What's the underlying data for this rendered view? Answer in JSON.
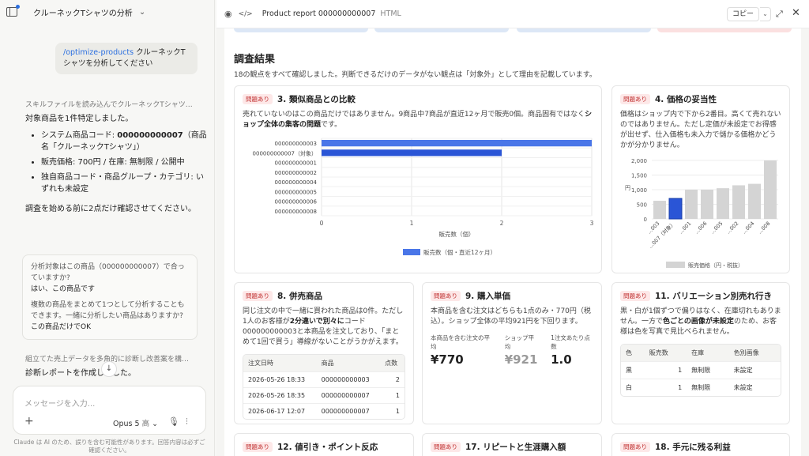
{
  "chat": {
    "title": "クルーネックTシャツの分析",
    "user_message_cmd": "/optimize-products",
    "user_message_text": " クルーネックTシャツを分析してください",
    "status_1": "スキルファイルを読み込んでクルーネックTシャツ…",
    "para_1": "対象商品を1件特定しました。",
    "bullets": [
      {
        "pre": "システム商品コード: ",
        "bold": "000000000007",
        "post": "（商品名「クルーネックTシャツ」）"
      },
      {
        "pre": "販売価格: 700円 / 在庫: 無制限 / 公開中",
        "bold": "",
        "post": ""
      },
      {
        "pre": "独自商品コード・商品グループ・カテゴリ: いずれも未設定",
        "bold": "",
        "post": ""
      }
    ],
    "para_2": "調査を始める前に2点だけ確認させてください。",
    "qa": [
      {
        "q": "分析対象はこの商品（000000000007）で合っていますか?",
        "a": "はい、この商品です"
      },
      {
        "q": "複数の商品をまとめて1つとして分析することもできます。一緒に分析したい商品はありますか?",
        "a": "この商品だけでOK"
      }
    ],
    "status_2": "組立てた売上データを多角的に診断し改善案を構…",
    "para_3": "診断レポートを作成しました。",
    "input_placeholder": "メッセージを入力...",
    "model": "Opus 5",
    "model_thinking": "高",
    "disclaimer": "Claude は AI のため、誤りを含む可能性があります。回答内容は必ずご確認ください。"
  },
  "report": {
    "title": "Product report 000000000007",
    "type": "HTML",
    "copy_label": "コピー",
    "section_title": "調査結果",
    "section_desc": "18の観点をすべて確認しました。判断できるだけのデータがない観点は「対象外」として理由を記載しています。",
    "badge": "問題あり",
    "cards": {
      "c3": {
        "title": "3. 類似商品との比較",
        "text_pre": "売れていないのはこの商品だけではありません。9商品中7商品が直近12ヶ月で販売0個。商品固有ではなく",
        "text_bold": "ショップ全体の集客の問題",
        "text_post": "です。"
      },
      "c4": {
        "title": "4. 価格の妥当性",
        "text": "価格はショップ内で下から2番目。高くて売れないのではありません。ただし定価が未設定でお得感が出せず、仕入価格も未入力で儲かる価格かどうかが分かりません。"
      },
      "c8": {
        "title": "8. 併売商品",
        "text_pre": "同じ注文の中で一緒に買われた商品は0件。ただし1人のお客様が",
        "text_bold": "2分違いで別々に",
        "text_post": "コード000000000003と本商品を注文しており、「まとめて1回で買う」導線がないことがうかがえます。",
        "headers": [
          "注文日時",
          "商品",
          "点数"
        ],
        "rows": [
          [
            "2026-05-26 18:33",
            "000000000003",
            "2"
          ],
          [
            "2026-05-26 18:35",
            "000000000007",
            "1"
          ],
          [
            "2026-06-17 12:07",
            "000000000007",
            "1"
          ]
        ]
      },
      "c9": {
        "title": "9. 購入単価",
        "text": "本商品を含む注文はどちらも1点のみ・770円（税込）。ショップ全体の平均921円を下回ります。",
        "metrics": [
          {
            "label": "本商品を含む注文の平均",
            "value": "¥770"
          },
          {
            "label": "ショップ平均",
            "value": "¥921"
          },
          {
            "label": "1注文あたり点数",
            "value": "1.0"
          }
        ]
      },
      "c11": {
        "title": "11. バリエーション別売れ行き",
        "text_pre": "黒・白が1個ずつで偏りはなく、在庫切れもありません。一方で",
        "text_bold": "色ごとの画像が未設定",
        "text_post": "のため、お客様は色を写真で見比べられません。",
        "headers": [
          "色",
          "販売数",
          "在庫",
          "色別画像"
        ],
        "rows": [
          [
            "黒",
            "1",
            "無制限",
            "未設定"
          ],
          [
            "白",
            "1",
            "無制限",
            "未設定"
          ]
        ]
      },
      "c12": {
        "title": "12. 値引き・ポイント反応"
      },
      "c17": {
        "title": "17. リピートと生涯購入額"
      },
      "c18": {
        "title": "18. 手元に残る利益"
      }
    }
  },
  "chart_data": [
    {
      "type": "bar",
      "orientation": "horizontal",
      "categories": [
        "000000000003",
        "000000000007（対象）",
        "000000000001",
        "000000000002",
        "000000000004",
        "000000000005",
        "000000000006",
        "000000000008"
      ],
      "values": [
        3,
        2,
        0,
        0,
        0,
        0,
        0,
        0
      ],
      "xlabel": "販売数（個）",
      "xlim": [
        0,
        3
      ],
      "xticks": [
        0,
        1,
        2,
        3
      ],
      "legend": "販売数（個・直近12ヶ月）",
      "legend_position": "bottom",
      "colors": {
        "bar": "#4a76e8",
        "highlight": "#2a55d6"
      },
      "grid": true
    },
    {
      "type": "bar",
      "categories": [
        "...003",
        "...007（対象）",
        "...001",
        "...006",
        "...005",
        "...002",
        "...004",
        "...008"
      ],
      "values": [
        620,
        700,
        1000,
        1000,
        1050,
        1150,
        1200,
        2000
      ],
      "ylabel": "円",
      "ylim": [
        0,
        2000
      ],
      "yticks": [
        "0",
        "500",
        "1,000",
        "1,500",
        "2,000"
      ],
      "legend": "販売価格（円・税抜）",
      "legend_position": "bottom",
      "colors": {
        "bar": "#d4d4d4",
        "highlight": "#2a55d6"
      },
      "highlight_index": 1,
      "grid": true
    }
  ]
}
